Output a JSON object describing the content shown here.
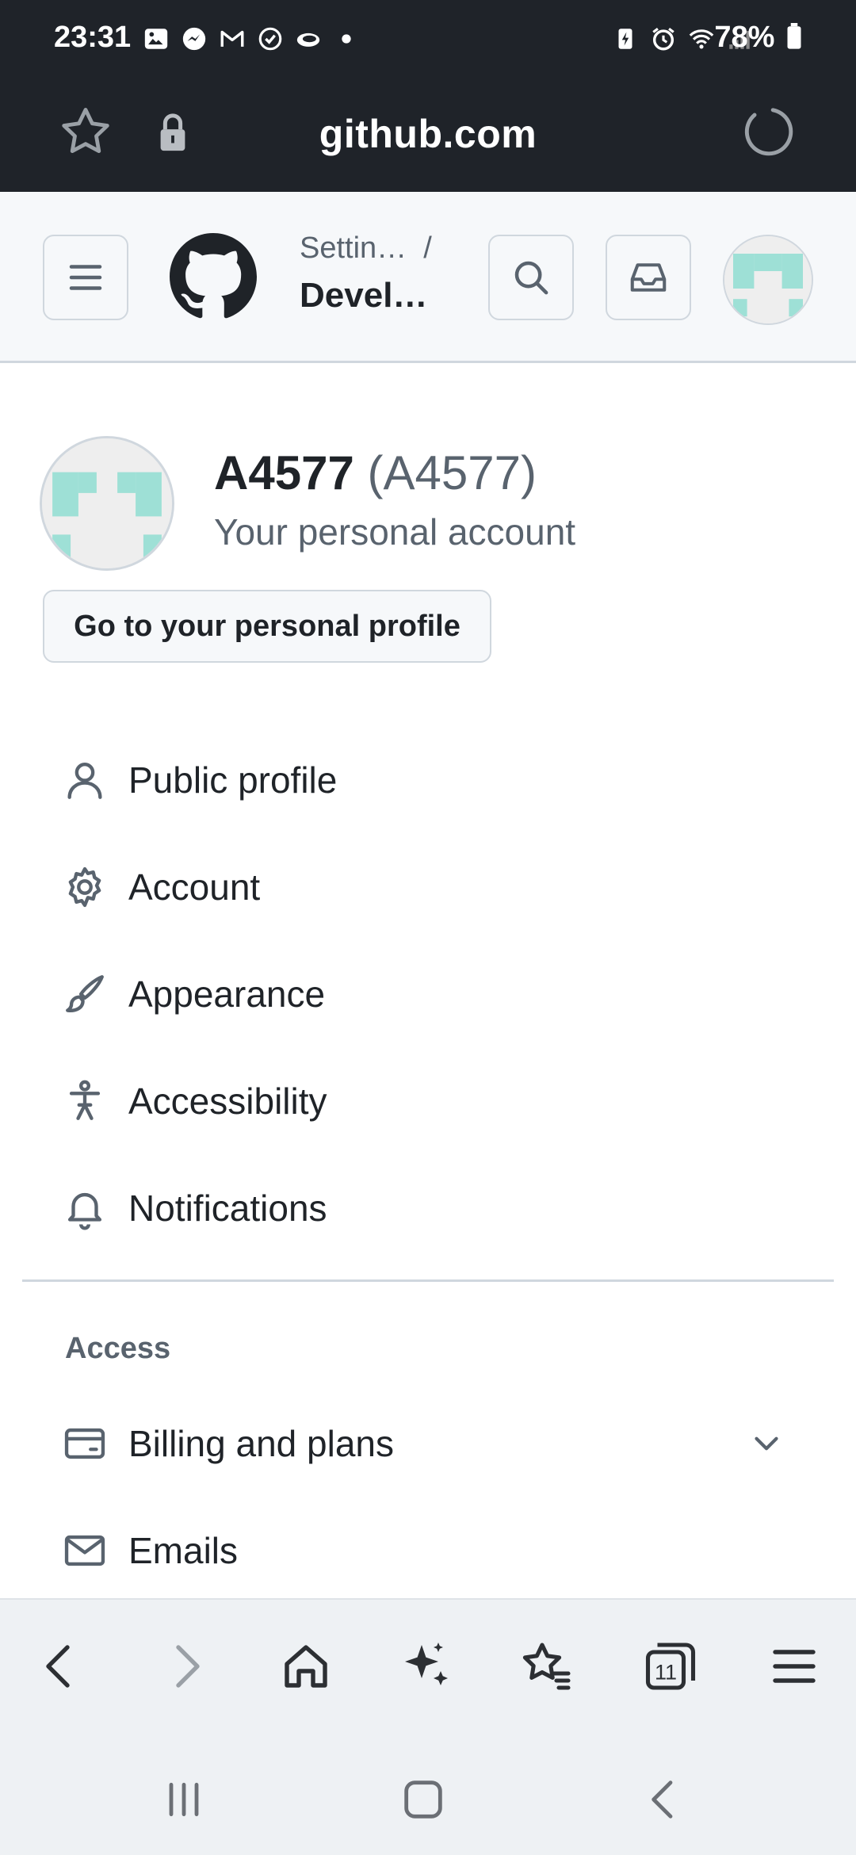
{
  "status_bar": {
    "time": "23:31",
    "battery": "78%",
    "left_icons": [
      "gallery-icon",
      "messenger-icon",
      "gmail-icon",
      "task-check-icon",
      "cloud-icon",
      "dot-icon"
    ],
    "right_icons": [
      "battery-saver-icon",
      "alarm-icon",
      "wifi-icon",
      "signal-icon",
      "battery-icon"
    ]
  },
  "browser": {
    "url": "github.com",
    "toolbar": [
      "back-icon",
      "forward-icon",
      "home-icon",
      "sparkle-icon",
      "bookmarks-icon",
      "tabs-icon",
      "menu-icon"
    ],
    "tab_count": "11"
  },
  "header": {
    "breadcrumb_parent": "Settin…",
    "breadcrumb_separator": "/",
    "breadcrumb_current": "Devel…"
  },
  "account": {
    "display_name": "A4577",
    "login": "(A4577)",
    "subtitle": "Your personal account",
    "profile_button": "Go to your personal profile"
  },
  "nav": {
    "items": [
      {
        "label": "Public profile",
        "icon": "person-icon"
      },
      {
        "label": "Account",
        "icon": "gear-icon"
      },
      {
        "label": "Appearance",
        "icon": "paintbrush-icon"
      },
      {
        "label": "Accessibility",
        "icon": "accessibility-icon"
      },
      {
        "label": "Notifications",
        "icon": "bell-icon"
      }
    ],
    "access_heading": "Access",
    "access_items": [
      {
        "label": "Billing and plans",
        "icon": "credit-card-icon",
        "expandable": true
      },
      {
        "label": "Emails",
        "icon": "mail-icon"
      }
    ]
  },
  "colors": {
    "system_bar": "#1f2329",
    "header_bg": "#f6f8fa",
    "border": "#d0d7de",
    "text_primary": "#1f2328",
    "text_muted": "#59636e",
    "avatar_accent": "#9ee0d6"
  }
}
